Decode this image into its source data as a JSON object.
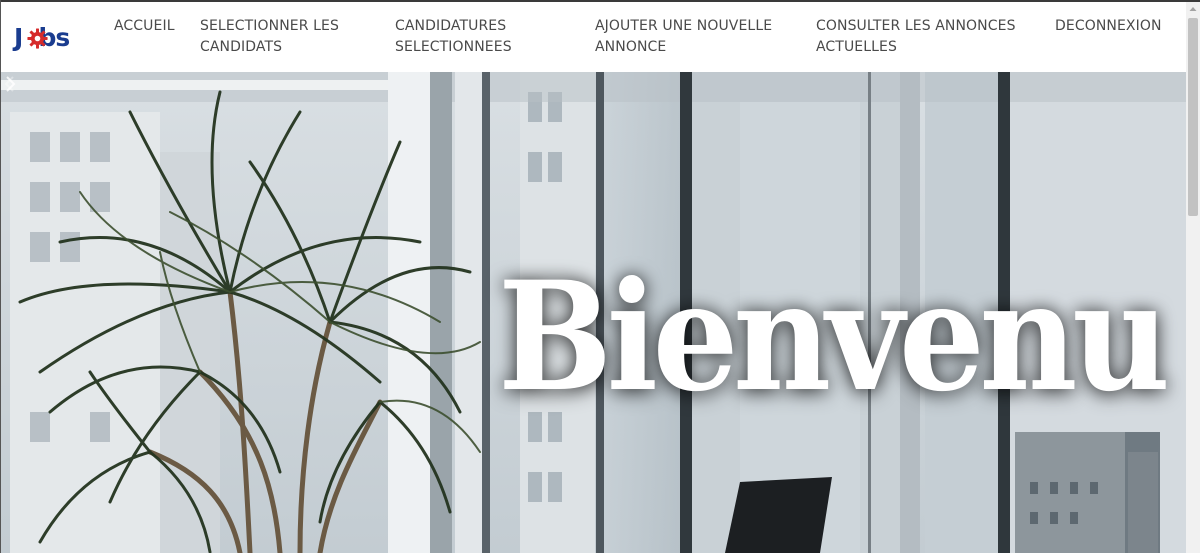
{
  "brand": {
    "logo_text": "Jobs",
    "logo_color": "#1a3c8f",
    "gear_color": "#d62b2b"
  },
  "nav": {
    "accueil": {
      "line1": "ACCUEIL",
      "line2": ""
    },
    "selectionner": {
      "line1": "SELECTIONNER LES",
      "line2": "CANDIDATS"
    },
    "candidatures": {
      "line1": "CANDIDATURES",
      "line2": "SELECTIONNEES"
    },
    "ajouter": {
      "line1": "AJOUTER UNE NOUVELLE",
      "line2": "ANNONCE"
    },
    "consulter": {
      "line1": "CONSULTER LES ANNONCES",
      "line2": "ACTUELLES"
    },
    "deconnexion": {
      "line1": "DECONNEXION",
      "line2": ""
    }
  },
  "hero": {
    "title": "Bienvenu"
  },
  "icons": {
    "next": "chevron-right-icon",
    "prev": "chevron-left-icon",
    "scroll_up": "triangle-up-icon"
  }
}
